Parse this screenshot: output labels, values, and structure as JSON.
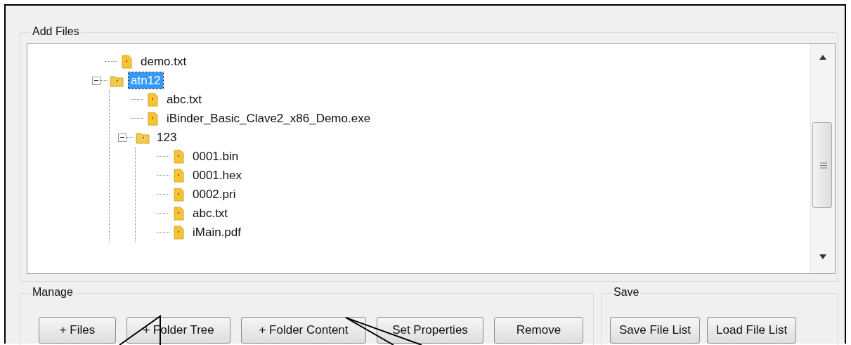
{
  "add_files": {
    "label": "Add Files",
    "tree": [
      {
        "label": "demo.txt",
        "kind": "file",
        "selected": false
      },
      {
        "label": "atn12",
        "kind": "folder",
        "expanded": true,
        "selected": true,
        "children": [
          {
            "label": "abc.txt",
            "kind": "file",
            "selected": false
          },
          {
            "label": "iBinder_Basic_Clave2_x86_Demo.exe",
            "kind": "file",
            "selected": false
          },
          {
            "label": "123",
            "kind": "folder",
            "expanded": true,
            "selected": false,
            "children": [
              {
                "label": "0001.bin",
                "kind": "file",
                "selected": false
              },
              {
                "label": "0001.hex",
                "kind": "file",
                "selected": false
              },
              {
                "label": "0002.pri",
                "kind": "file",
                "selected": false
              },
              {
                "label": "abc.txt",
                "kind": "file",
                "selected": false
              },
              {
                "label": "iMain.pdf",
                "kind": "file",
                "selected": false
              }
            ]
          }
        ]
      }
    ]
  },
  "manage": {
    "label": "Manage",
    "buttons": [
      "+ Files",
      "+ Folder Tree",
      "+ Folder Content",
      "Set Properties",
      "Remove"
    ]
  },
  "save": {
    "label": "Save",
    "buttons": [
      "Save File List",
      "Load File List"
    ]
  }
}
